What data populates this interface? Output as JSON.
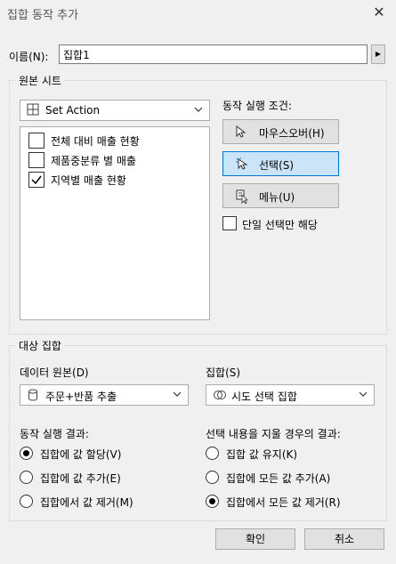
{
  "window": {
    "title": "집합 동작 추가",
    "close_glyph": "✕"
  },
  "name_field": {
    "label": "이름(N):",
    "value": "집합1",
    "arrow_glyph": "▶"
  },
  "source_sheets": {
    "group_label": "원본 시트",
    "sheet_dropdown": {
      "value": "Set Action",
      "icon": "grid-icon"
    },
    "sheets": [
      {
        "label": "전체 대비 매출 현황",
        "checked": false
      },
      {
        "label": "제품중분류 별 매출",
        "checked": false
      },
      {
        "label": "지역별 매출 현황",
        "checked": true
      }
    ]
  },
  "trigger": {
    "label": "동작 실행 조건:",
    "options": [
      {
        "label": "마우스오버(H)",
        "icon": "pointer-icon",
        "selected": false
      },
      {
        "label": "선택(S)",
        "icon": "select-pointer-icon",
        "selected": true
      },
      {
        "label": "메뉴(U)",
        "icon": "menu-pointer-icon",
        "selected": false
      }
    ],
    "single_select_label": "단일 선택만 해당",
    "single_select_checked": false
  },
  "target_set": {
    "group_label": "대상 집합",
    "datasource_label": "데이터 원본(D)",
    "datasource_value": "주문+반품 추출",
    "set_label": "집합(S)",
    "set_value": "시도 선택 집합"
  },
  "run_result": {
    "label": "동작 실행 결과:",
    "options": [
      {
        "label": "집합에 값 할당(V)",
        "selected": true
      },
      {
        "label": "집합에 값 추가(E)",
        "selected": false
      },
      {
        "label": "집합에서 값 제거(M)",
        "selected": false
      }
    ]
  },
  "clear_result": {
    "label": "선택 내용을 지울 경우의 결과:",
    "options": [
      {
        "label": "집합 값 유지(K)",
        "selected": false
      },
      {
        "label": "집합에 모든 값 추가(A)",
        "selected": false
      },
      {
        "label": "집합에서 모든 값 제거(R)",
        "selected": true
      }
    ]
  },
  "footer": {
    "ok_label": "확인",
    "cancel_label": "취소"
  },
  "colors": {
    "background": "#f0f0f0",
    "selected_button": "#cce4f7",
    "selected_border": "#0078d7"
  }
}
